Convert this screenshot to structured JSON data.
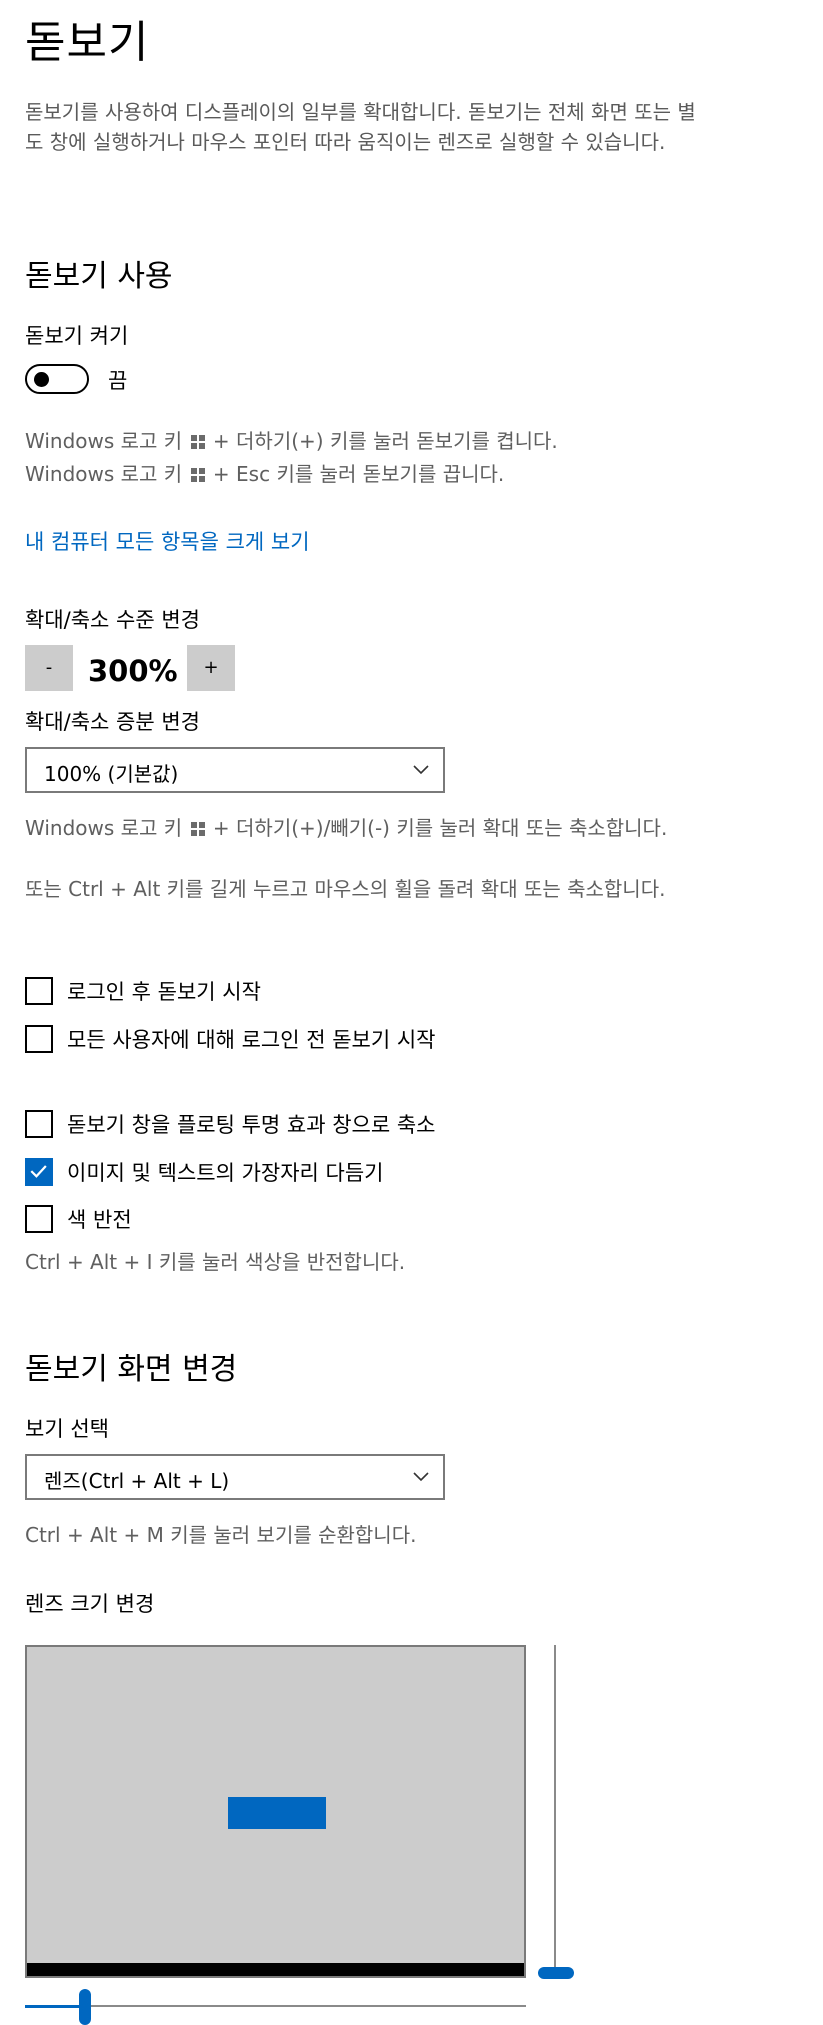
{
  "page_title": "돋보기",
  "description": "돋보기를 사용하여 디스플레이의 일부를 확대합니다. 돋보기는 전체 화면 또는 별도 창에 실행하거나 마우스 포인터 따라 움직이는 렌즈로 실행할 수 있습니다.",
  "use_section": {
    "heading": "돋보기 사용",
    "toggle_label": "돋보기 켜기",
    "toggle_state": "끔",
    "toggle_on": false,
    "hint_on_pre": "Windows 로고 키",
    "hint_on_post": "+ 더하기(+) 키를 눌러 돋보기를 켭니다.",
    "hint_off_pre": "Windows 로고 키",
    "hint_off_post": "+ Esc 키를 눌러 돋보기를 끕니다.",
    "link": "내 컴퓨터 모든 항목을 크게 보기"
  },
  "zoom": {
    "label": "확대/축소 수준 변경",
    "minus": "-",
    "value": "300%",
    "plus": "+",
    "increment_label": "확대/축소 증분 변경",
    "increment_value": "100% (기본값)",
    "hint1_pre": "Windows 로고 키",
    "hint1_post": "+ 더하기(+)/빼기(-) 키를 눌러 확대 또는 축소합니다.",
    "hint2": "또는 Ctrl + Alt 키를 길게 누르고 마우스의 휠을 돌려 확대 또는 축소합니다."
  },
  "checkboxes": [
    {
      "label": "로그인 후 돋보기 시작",
      "checked": false
    },
    {
      "label": "모든 사용자에 대해 로그인 전 돋보기 시작",
      "checked": false
    },
    {
      "label": "돋보기 창을 플로팅 투명 효과 창으로 축소",
      "checked": false
    },
    {
      "label": "이미지 및 텍스트의 가장자리 다듬기",
      "checked": true
    },
    {
      "label": "색 반전",
      "checked": false
    }
  ],
  "invert_hint": "Ctrl + Alt + I 키를 눌러 색상을 반전합니다.",
  "view_section": {
    "heading": "돋보기 화면 변경",
    "select_label": "보기 선택",
    "select_value": "렌즈(Ctrl + Alt + L)",
    "hint": "Ctrl + Alt + M 키를 눌러 보기를 순환합니다.",
    "lens_label": "렌즈 크기 변경"
  },
  "colors": {
    "accent": "#0067c0",
    "preview_bg": "#cccccc"
  }
}
